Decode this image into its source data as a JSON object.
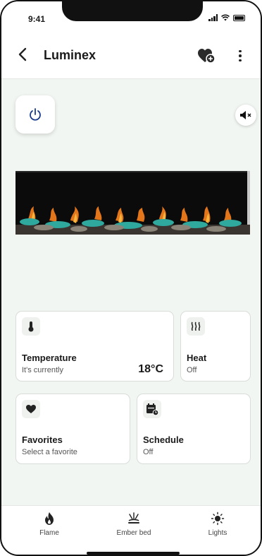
{
  "status": {
    "time": "9:41"
  },
  "header": {
    "title": "Luminex"
  },
  "cards": {
    "temperature": {
      "label": "Temperature",
      "sub": "It's currently",
      "value": "18°C"
    },
    "heat": {
      "label": "Heat",
      "sub": "Off"
    },
    "favorites": {
      "label": "Favorites",
      "sub": "Select a favorite"
    },
    "schedule": {
      "label": "Schedule",
      "sub": "Off"
    }
  },
  "nav": [
    {
      "label": "Flame",
      "icon": "flame-icon"
    },
    {
      "label": "Ember bed",
      "icon": "ember-bed-icon"
    },
    {
      "label": "Lights",
      "icon": "sun-icon"
    }
  ]
}
